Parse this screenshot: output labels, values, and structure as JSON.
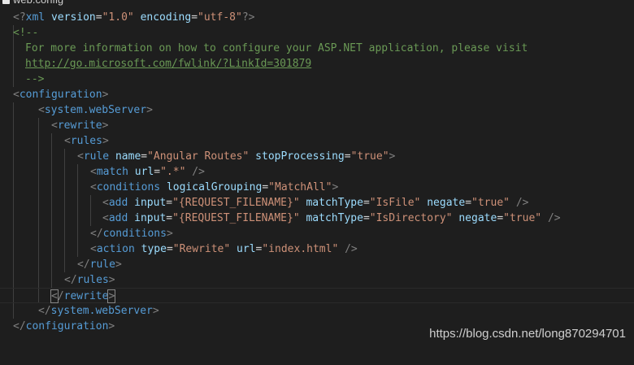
{
  "tab": {
    "filename": "web.config",
    "icon": "file-icon"
  },
  "code": {
    "xml_decl": {
      "open": "<?",
      "name": "xml",
      "attr1": "version",
      "val1": "\"1.0\"",
      "attr2": "encoding",
      "val2": "\"utf-8\"",
      "close": "?>"
    },
    "comment_open": "<!--",
    "comment_line1": "For more information on how to configure your ASP.NET application, please visit",
    "comment_link": "http://go.microsoft.com/fwlink/?LinkId=301879",
    "comment_close": "-->",
    "configuration": "configuration",
    "system_webserver": "system.webServer",
    "rewrite": "rewrite",
    "rules": "rules",
    "rule": {
      "name": "rule",
      "attr1": "name",
      "val1": "\"Angular Routes\"",
      "attr2": "stopProcessing",
      "val2": "\"true\""
    },
    "match": {
      "name": "match",
      "attr1": "url",
      "val1": "\".*\""
    },
    "conditions": {
      "name": "conditions",
      "attr1": "logicalGrouping",
      "val1": "\"MatchAll\""
    },
    "add1": {
      "name": "add",
      "attr1": "input",
      "val1": "\"{REQUEST_FILENAME}\"",
      "attr2": "matchType",
      "val2": "\"IsFile\"",
      "attr3": "negate",
      "val3": "\"true\""
    },
    "add2": {
      "name": "add",
      "attr1": "input",
      "val1": "\"{REQUEST_FILENAME}\"",
      "attr2": "matchType",
      "val2": "\"IsDirectory\"",
      "attr3": "negate",
      "val3": "\"true\""
    },
    "action": {
      "name": "action",
      "attr1": "type",
      "val1": "\"Rewrite\"",
      "attr2": "url",
      "val2": "\"index.html\""
    }
  },
  "watermark": "https://blog.csdn.net/long870294701",
  "colors": {
    "background": "#1e1e1e",
    "tag": "#569cd6",
    "attribute": "#9cdcfe",
    "string": "#ce9178",
    "comment": "#6a9955",
    "punctuation": "#808080"
  }
}
